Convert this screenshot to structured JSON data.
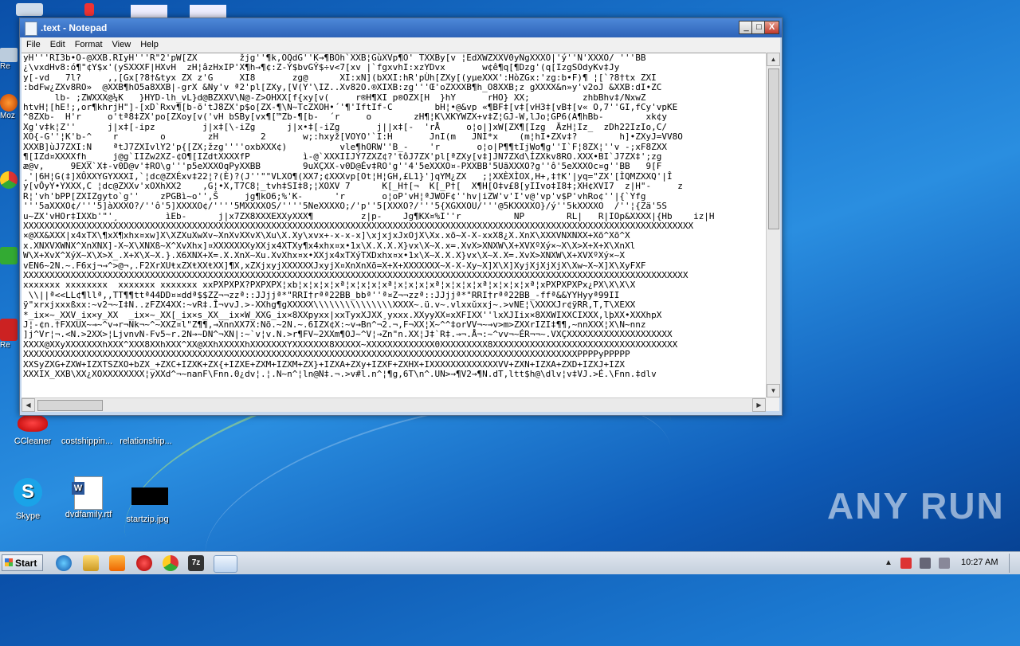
{
  "desktop": {
    "icons": [
      {
        "label": "CCleaner"
      },
      {
        "label": "costshippin..."
      },
      {
        "label": "relationship..."
      },
      {
        "label": "Skype"
      },
      {
        "label": "dvdfamily.rtf"
      },
      {
        "label": "startzip.jpg"
      }
    ],
    "left_labels": [
      "Re",
      "Moz",
      "A",
      "Re"
    ],
    "watermark": "ANY RUN"
  },
  "window": {
    "title": ".text - Notepad",
    "buttons": {
      "minimize": "_",
      "maximize": "□",
      "close": "X"
    },
    "menu": [
      "File",
      "Edit",
      "Format",
      "View",
      "Help"
    ],
    "content_lines": [
      "yH'''RI3b•O-@XXB.RIyH'''R\"2'pW[ZX        žjg''¶k,OQdG''K→¶BOh`XXB¦GùXVp¶O' TXXBy[v ¦EdXWZXXV0yNgXXXO|'ý''N'XXXO/ '''BB",
      "¿\\vxdHv8:ó¶\"¢Y$x'(ySXXXF|HXvH  zH¦âzHxIP'X¶h→¶¢:Z-Ý$bvGÝ$÷v<7[xv |`fgxvhI:xzYDvx       w¢ê¶q[¶Dzg'(q[IzgSOdyKv‡Jy",
      "y[-vd   7l?     ,,[Gx[?8†&tyx ZX z'G     XI8       zg@      XI:xN](bXXI:hR'pÙh[ZXy[(yµeXXX':HòZGx:'zg:b•F)¶ ¦[`?8†tx ZXI",
      ":bdFw¿ZXv8RO»  @XXB¶hO5a8XXB|-grX &Ny'v ª2'pl[ZXy,[V(Y'\\IZ..Xv82O.®XIXB:zg'''Œ'oZXXXB¶h_O8XXB;z gXXXX&n»y'v2oJ &XXB:dI•ZC",
      "      lb- ;ZWXXX@¼K   }HYD-lh_vL}d@BZXXV\\N@-Z>OHXX[f{xy[v(     r®H¶XI p®OZX[H  }hY      rHO} XX;          zhbBhv‡/NxwZ",
      "htvH¦[hE!;,or¶khrjH\"]-[xD`Rxv¶[b-õ'tJ8ZX'p$o[ZX-¶\\N~TcZXOH•´'¶'IftIf-C        bH¦•@&vp «¶BF‡[v‡[vH3‡[vB‡[v« O,7''GI,fCy'vpKE",
      "^8ZXb-  H'r     o'tª8‡ZX'po[ZXoy[v('vH bSBy[vx¶[™Zb-¶[b-  ´r     o        zH¶¦K\\XKYWZX+v‡Z¦GJ-W,lJo¦GP6(A¶hBb-        xk¢y",
      "Xg'v‡k¦Z''      j|x‡[-ipz         j|x‡[\\-iZg      j|x•‡[-iZg       j||x‡[-  'rÅ     o¦o|]xW[ZX¶[Izg  ÄzH¦Iz_  zDh22IzIo,C/",
      "XO{-G''¦K'b-^    r        o        zH        2       w;:hxyž[VOYO'`I:H       JnI(m   JNI*x    (m¦hI•ZXv‡?        h]•ZXyJ=VV8O",
      "XXXB]ùJ7ZXI:N    ªtJ7ZXIvlY2'p{[ZX;žzg''''oxbXXX¢)          vle¶hORW''B_-    'r       o¦o|P¶¶tIjWo¶g''I`F¦8ZX¦''v -;xF8ZXX",
      "¶[IZd¤XXXXfh_    j@g`IIZw2XZ-¢O¶[IZdtXXXXfP          ì-@`XXXIIJÝ7ZXZ¢?'tôJ7ZX'pl[ªZXy[v‡]JN7ZXd\\ÍZXkv8RO.XXX•BI`J7ZX‡';zg",
      "æ@v,     9EXX`X‡-v0D@v'‡RO\\g'''p5eXXXOqPyXXBB        9uXÇXX-v0D@Év‡RO'g''4'5eXXXO¤-PXXBB'5UãXXXO?g''ô'5eXXXOc¤g''BB   9[F",
      "¸'|6H¦G(‡]XÔXXYGYXXXI,`¦dc@ZXÉxv‡22¦?(È)?(J''\"\"VLXO¶(XX7;¢XXXvp[Ot¦H¦GH,£L1}']qYM¿ZX   ;¦XXÈXÌOX,H+,‡†K'|yq=\"ZX'[ÌQMZXXQ'|Î",
      "y[vÔyY•YXXX,C ¦dc@ZXXv'xOXhXX2    ,G¦•X,T7C8¦_tvh‡SI‡8;¦XOXV 7      K[_H†[¬  K[_P†[  X¶H[O‡v£8[yIIvo‡I8‡;XH¢XVI7  z|H\"-     z",
      "R¦'vh'bPP[ZXIZgyto`g''    zPGBì~o'',Š     jg¶kO6;%'K-      'r       o¦oP'vH¦ªJWOF¢''hv|iZW'v'I'v@'vp'v$P'vhRo¢''|{`Yfg",
      "'''5aXXXO¢/'''5]àXXXO?/''ô'5]XXXXO¢/''''5MXXXXOS/''''5NeXXXXO;/'p''5[XXXO?/'''5{XGXXOU/'''@5KXXXXO}/ý''5kXXXXO  /''¦{Zä'5S",
      "u~ZX'vHOr‡IXXb'\"'¸         ìEb-      j|x7ZX8XXXEXXyXXX¶         z|p-    Jg¶KX¤%I''r          NP        RL|   R|IOp&XXXX|{Hb    iz|H",
      "XXXXXXXXXXXXXXXXXXXXXXXXXXXXXXXXXXXXXXXXXXXXXXXXXXXXXXXXXXXXXXXXXXXXXXXXXXXXXXXXXXXXXXXXXXXXXXXXXXXXXXXXXXXXXXXXXXXXXXXXXXXXXXX",
      "×@XX&XXX|x4xTX\\¶xX¶xhx¤xw]X\\XZXuXwXv~XnXvXXvX\\Xu\\X.Xy\\xvx+-x-x-x]\\xjxjxJxOjX\\Xx.xõ~X-X-xxX8¿X.XnX\\XXXVNXNXX+Xõ^Xõ^X",
      "x.XNXVXWNX^XnXNX]-X~X\\XNXß~X^XvXhx]¤XXXXXXXyXXjx4XTXy¶x4xhx¤x•1x\\X.X.X.X}vx\\X~X.x=.XvX>XNXW\\X+XVXºXý×~X\\X>X+X+X\\XnXl",
      "W\\X+XvX^XýX~X\\X>X_.X+X\\X~X.}.X6XNX+X=.X.XnX~Xu.XvXhx¤x•XXjx4xTXýTXDxhx¤x•1x\\X~X.X.X}vx\\X~X.X=.XvX>XNXW\\X+XVXºXý×~X",
      "vEN6~2N.~.F6xj¬→^>@¬,.F2XrXUŧxZXŧXXŧXX]¶X,xZXjxyjXXXXXXJxyjX¤XnXnXõ=X+X+XXXXXXX~X-X-Xy~X]X\\X]XyjXjXjXjX\\Xw~X~X]X\\XyFXF",
      "XXXXXXXXXXXXXXXXXXXXXXXXXXXXXXXXXXXXXXXXXXXXXXXXXXXXXXXXXXXXXXXXXXXXXXXXXXXXXXXXXXXXXXXXXXXXXXXXXXXXXXXXXXXXXXXXXXXXXXXXXXXXXX",
      "xxxxxxx xxxxxxxx  xxxxxxx xxxxxxx xxPXPXPX?PXPXPX¦xb¦x¦x¦x¦xª¦x¦x¦x¦xª¦x¦x¦x¦xª¦x¦x¦x¦xª¦x¦x¦x¦xª¦xPXPXPXPx¿PX\\X\\X\\X",
      " \\\\||ª<<LL¢¶llª,,TT¶¶ttª44DD¤¤ddª$$ZZ¬¬zzª::JJjjª*\"RRI†rªª22BB_bbª''ª¤Z¬¬zzª::JJjjª*\"RRI†rªª22BB_-ffª&&YYHyyª99II",
      "ÿ\"xrxjxxxßxx:~v2¬~I‡N..zFZX4XX:~vR‡.Î¬vvJ.>-XXhg¶gXXXXX\\\\\\\\\\\\\\\\\\\\\\\\\\\\\\XXXX~.ü.v~.vlxxŭxxj~.>vNE¦\\XXXXJr¢ÿRR,T,T\\XEXX",
      "*_ix×~_XXV_ix×y_XX  _ix×~_XX[_ix×s_XX__ix×W_XXG_ix×8XXpyxx|xxTyxXJXX¸yxxx.XXyyXX¤xXFIXX''lxXJIix×8XXWIXXCIXXX,lþXX•XXXhpX",
      "J¦-¢n.†FXXUX~→~^v→r¬Nk¬~^~XXZ¤l\"Z¶¶,→XnnXX7X:Nõ.~2N.~.6IZX¢X:~v→Bn^¬2.¬,F¬XX¦X~^^‡orVV¬~→v>m>ZXXrIZI‡¶¶,~nnXXX¦X\\N~nnz",
      "]j^Vr¦¬.<N.>2XX>¦LjvnvN-Fv5~r.2N→~DN^¬XN|:~`v¦v.N.>r¶FV~2XXm¶OJ~^V¦→Zn\"n.XX¦J‡`R‡.→¬.Å¬:~^vv¬~ÉR¬¬~.VXÇXXXXXXXXXXXXXXXXXXXX",
      "XXXX@XXyXXXXXXXhXXX^XXX8XXhXXX^XX@XXhXXXXXhXXXXXXXYXXXXXXX8XXXXX~XXXXXXXXXXXXX0XXXXXXXXX8XXXXXXXXXXXXXXXXXXXXXXXXXXXXXXXXXXX",
      "XXXXXXXXXXXXXXXXXXXXXXXXXXXXXXXXXXXXXXXXXXXXXXXXXXXXXXXXXXXXXXXXXXXXXXXXXXXXXXXXXXXXXXXXXXXXXXXXXXXXXXXXXPPPPyPPPPP",
      "XXSyZXG+ZXW+IZXTSZXO+bZX_+ZXC+IZXK+ZX{+IZXE+ZXM+IZXM+ZX}+IZXA+ZXy+IZXF+ZXHX+IXXXXXXXXXXXXXVV+ZXN+IZXA+ZXD+IZXJ+IZX",
      "XXXIX_XXB\\XX¿XOXXXXXXXX¦yXXd^¬~nanF\\Fnn.0¿dv¦.¦.N~n^¦ln@N‡.¬.>v#l.n^¦¶g,6T\\n^.UN>→¶V2→¶N.dT,ltt$h@\\dlv¦v‡VJ.>É.\\Fnn.‡dlv"
    ]
  },
  "taskbar": {
    "start_label": "Start",
    "clock": "10:27 AM"
  }
}
